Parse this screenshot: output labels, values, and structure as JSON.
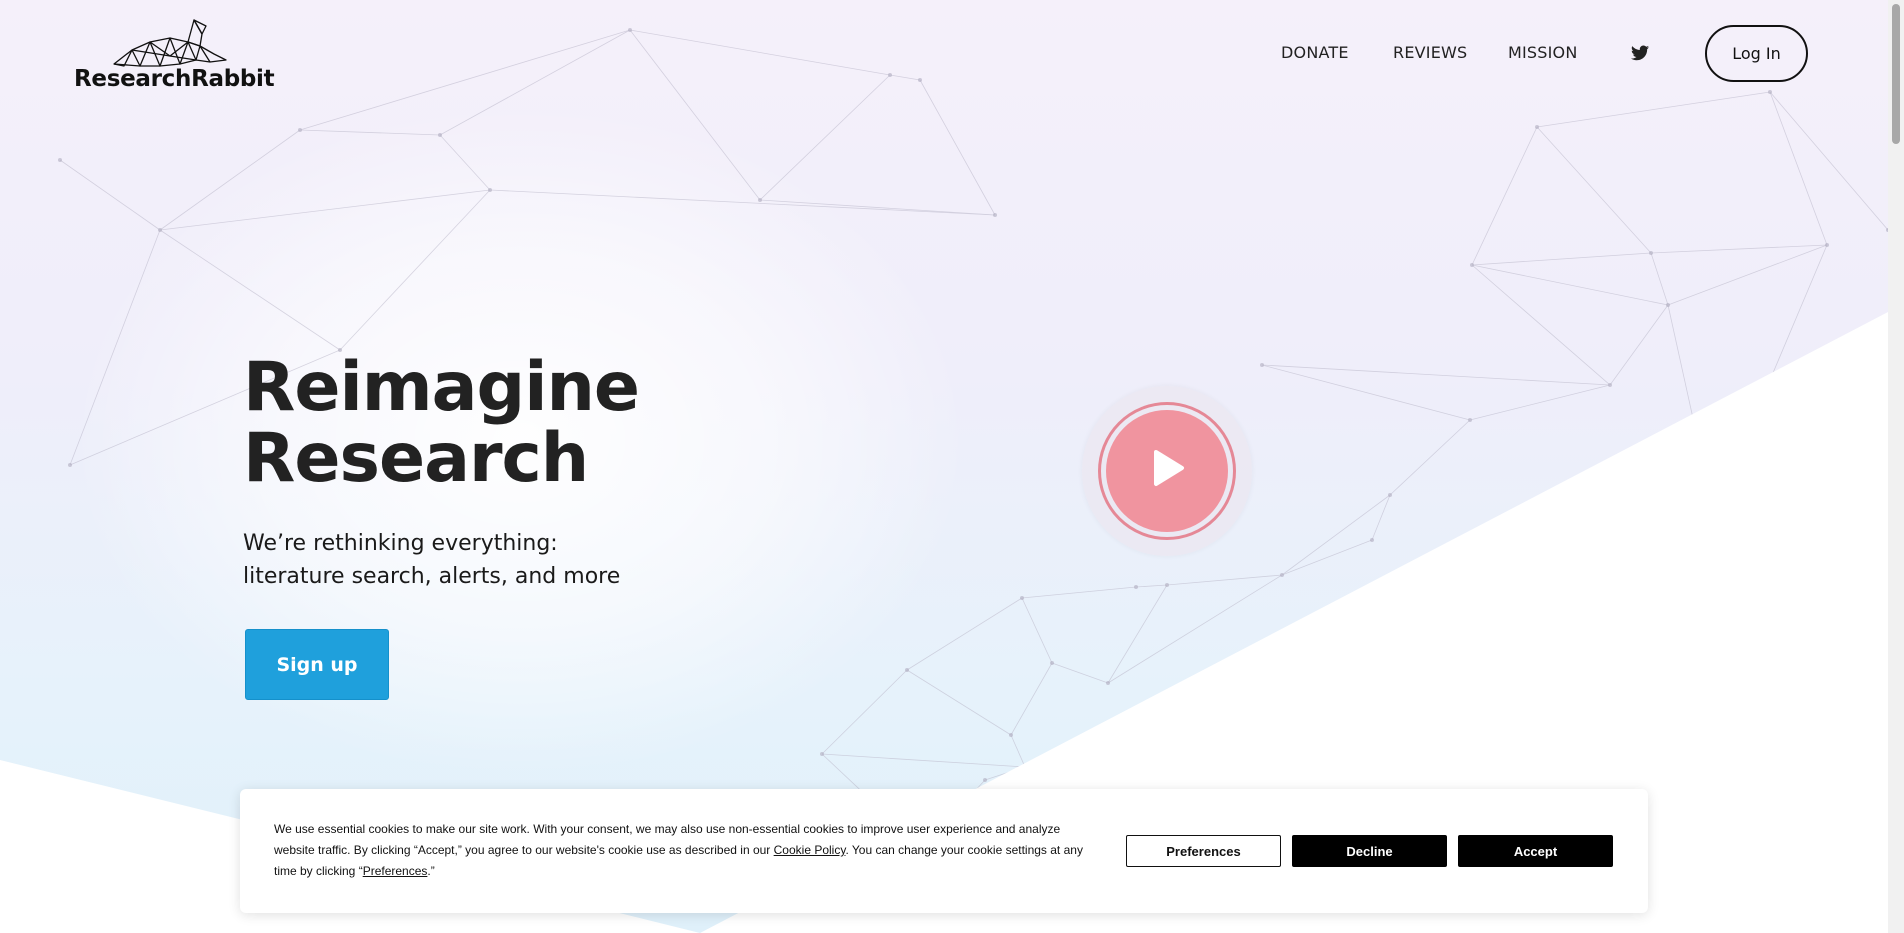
{
  "brand": {
    "name": "ResearchRabbit",
    "logo_icon": "rabbit-logo-icon"
  },
  "nav": {
    "items": [
      "DONATE",
      "REVIEWS",
      "MISSION"
    ],
    "social_icon": "twitter-icon",
    "login_label": "Log In"
  },
  "hero": {
    "title_line1": "Reimagine",
    "title_line2": "Research",
    "subtitle_line1": "We’re rethinking everything:",
    "subtitle_line2": "literature search, alerts, and more",
    "signup_label": "Sign up",
    "video_icon": "play-icon"
  },
  "cookie_banner": {
    "text_part1": "We use essential cookies to make our site work. With your consent, we may also use non-essential cookies to improve user experience and analyze website traffic. By clicking “Accept,” you agree to our website's cookie use as described in our ",
    "policy_link": "Cookie Policy",
    "text_part2": ". You can change your cookie settings at any time by clicking “",
    "preferences_link": "Preferences",
    "text_part3": ".”",
    "preferences_label": "Preferences",
    "decline_label": "Decline",
    "accept_label": "Accept"
  },
  "colors": {
    "signup": "#1fa0dc",
    "play_button": "#f0949f",
    "text_dark": "#222222"
  }
}
